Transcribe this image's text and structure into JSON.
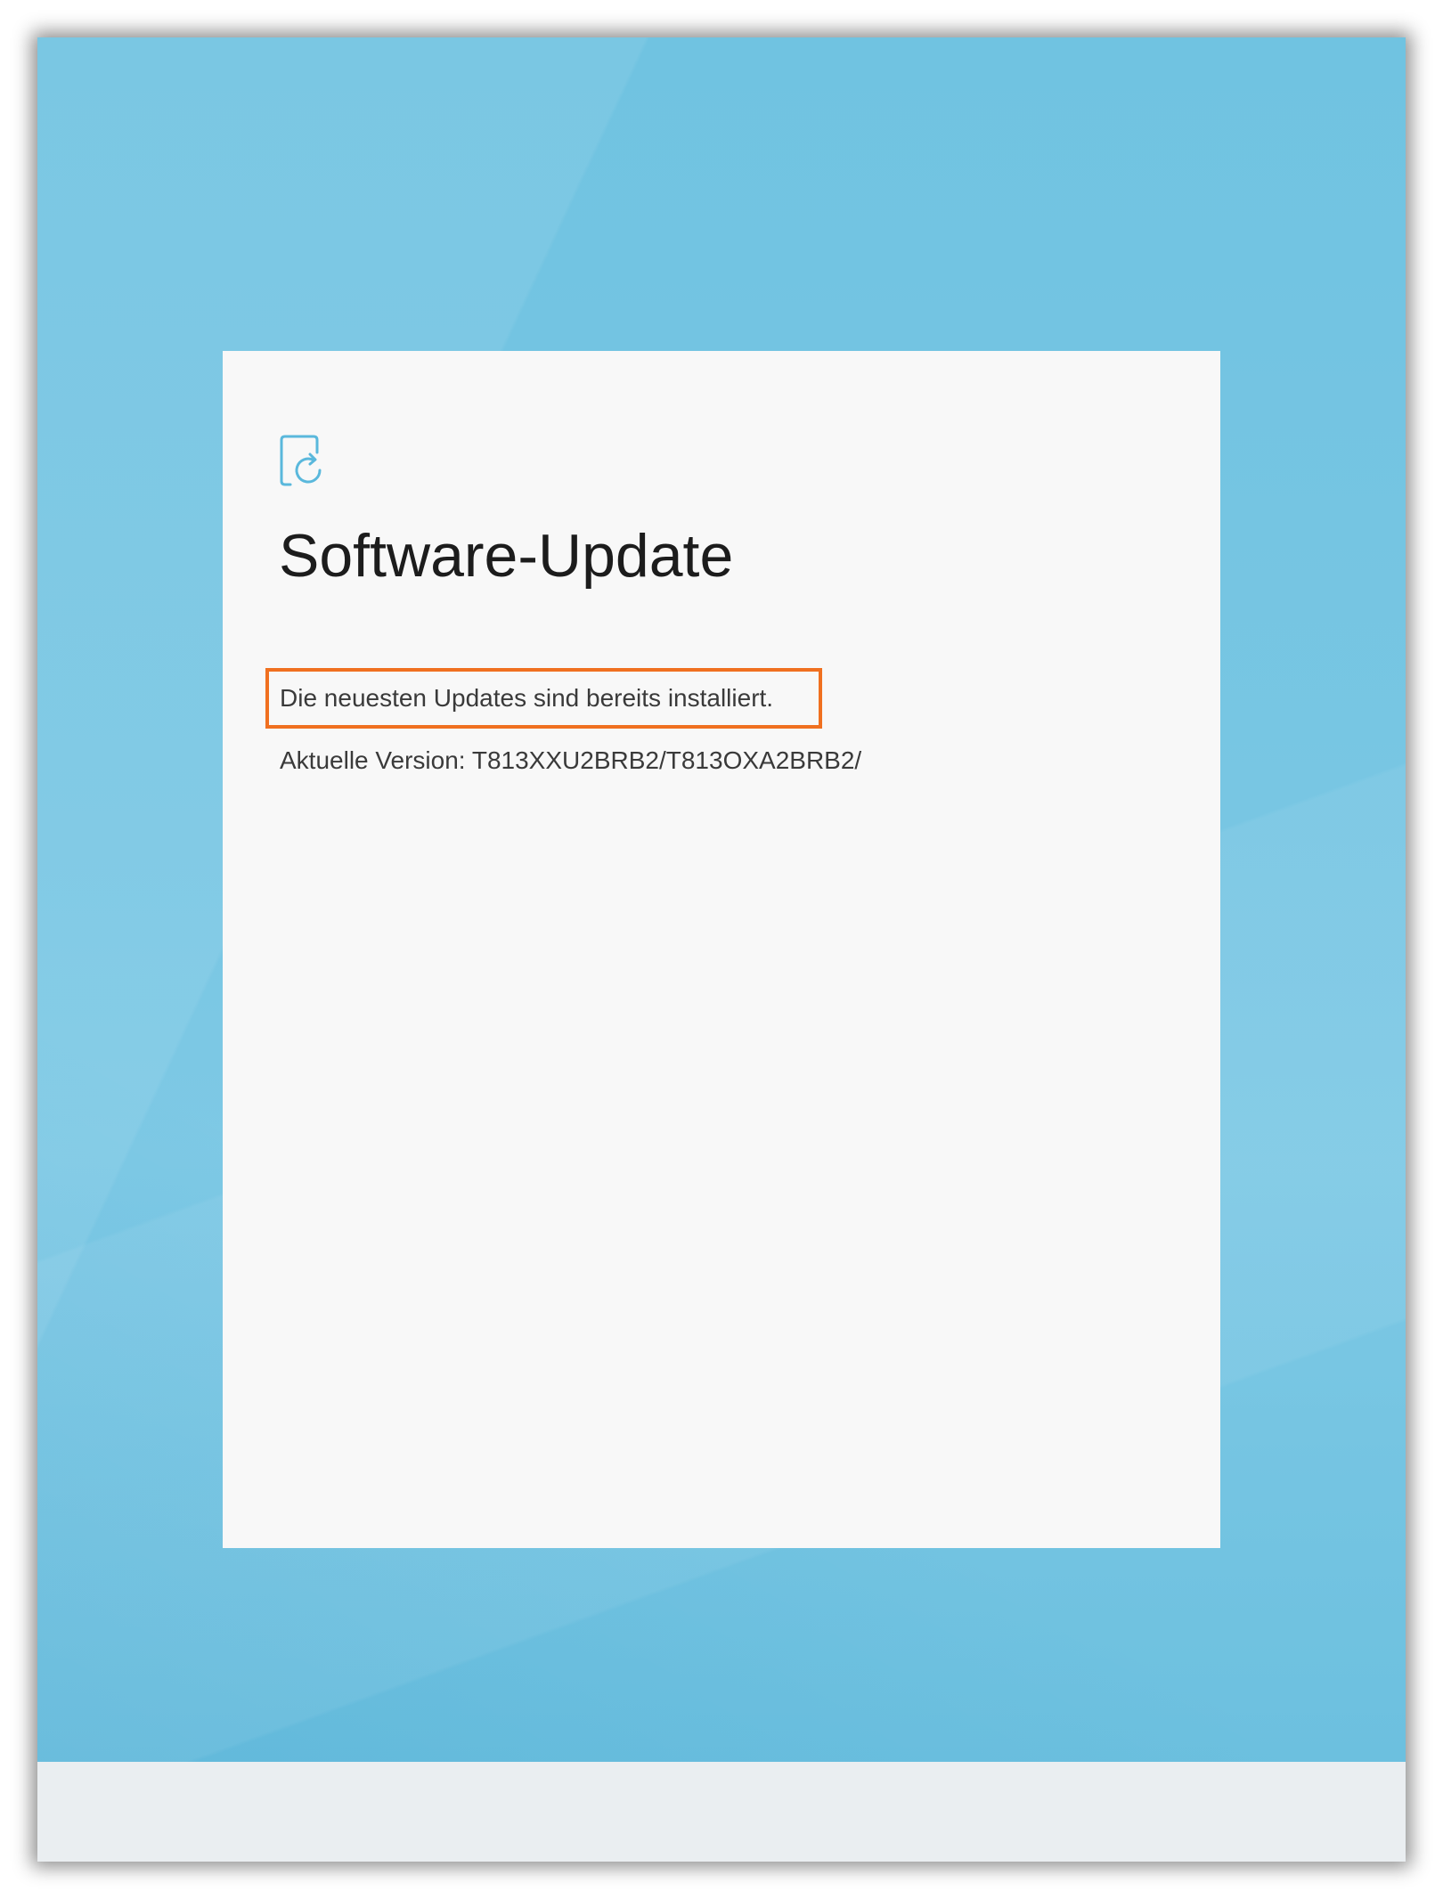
{
  "dialog": {
    "icon": "software-update-icon",
    "title": "Software-Update",
    "status": "Die neuesten Updates sind bereits installiert.",
    "version_label": "Aktuelle Version:",
    "version_value": "T813XXU2BRB2/T813OXA2BRB2/"
  },
  "colors": {
    "wallpaper": "#6fc1e0",
    "dialog_background": "#f8f8f8",
    "accent_icon": "#5ab8dc",
    "highlight": "#f07020",
    "bottom_bar": "#eaeef1"
  }
}
